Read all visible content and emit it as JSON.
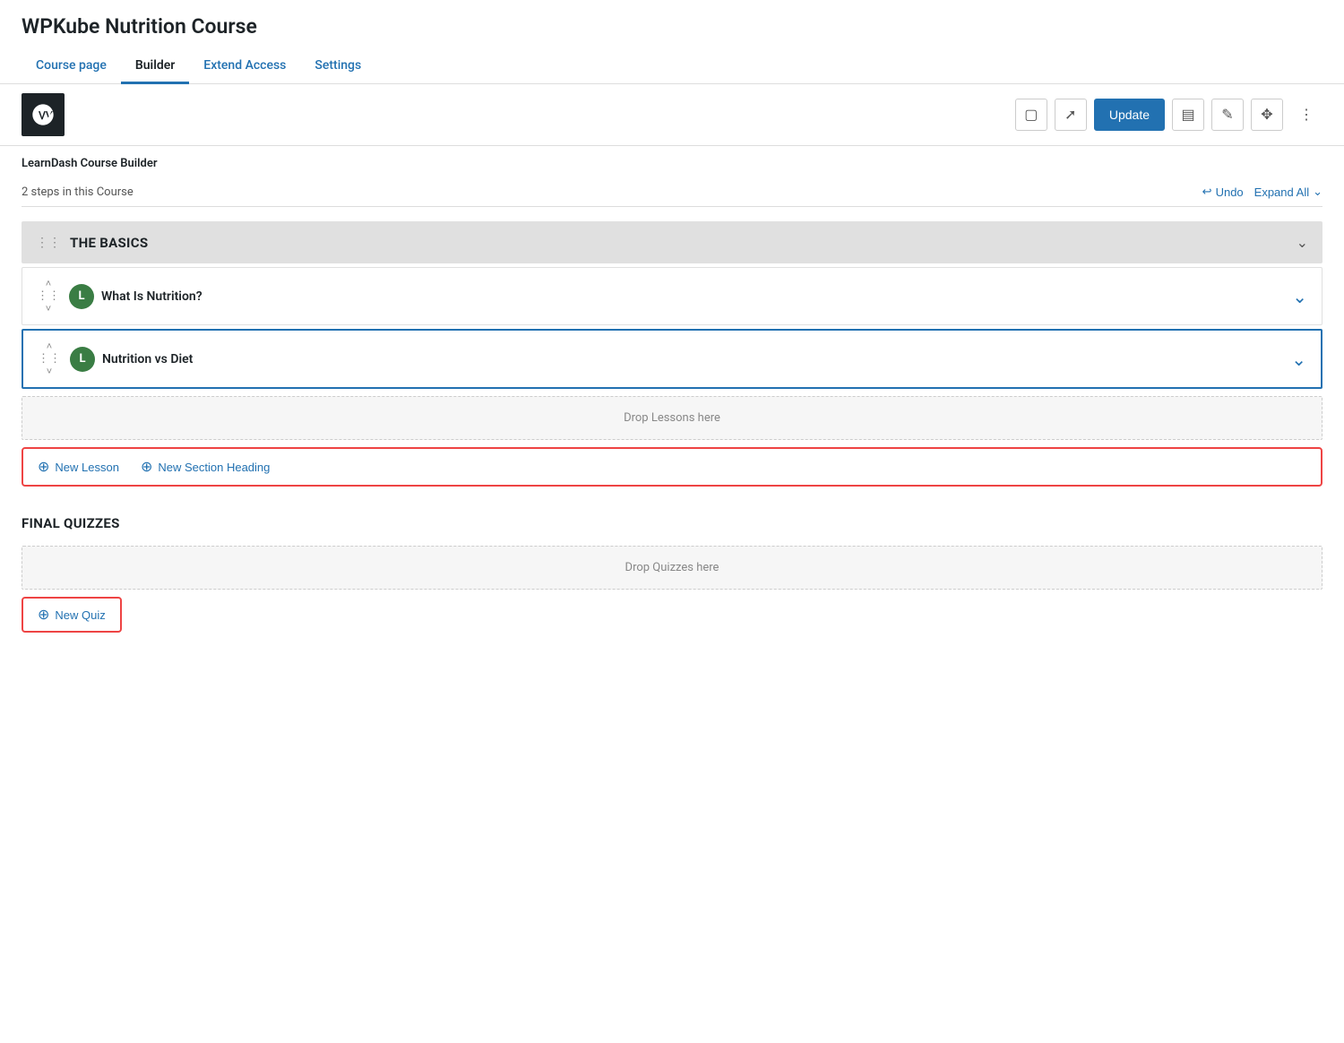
{
  "page": {
    "title": "WPKube Nutrition Course"
  },
  "tabs": [
    {
      "id": "course-page",
      "label": "Course page",
      "active": false
    },
    {
      "id": "builder",
      "label": "Builder",
      "active": true
    },
    {
      "id": "extend-access",
      "label": "Extend Access",
      "active": false
    },
    {
      "id": "settings",
      "label": "Settings",
      "active": false
    }
  ],
  "toolbar": {
    "update_label": "Update",
    "wp_logo": "W"
  },
  "builder": {
    "title": "LearnDash Course Builder",
    "steps_count": "2 steps in this Course",
    "undo_label": "Undo",
    "expand_all_label": "Expand All"
  },
  "sections": [
    {
      "id": "the-basics",
      "title": "THE BASICS",
      "lessons": [
        {
          "id": "what-is-nutrition",
          "title": "What Is Nutrition?",
          "badge": "L",
          "active": false
        },
        {
          "id": "nutrition-vs-diet",
          "title": "Nutrition vs Diet",
          "badge": "L",
          "active": true
        }
      ]
    }
  ],
  "drop_lessons_label": "Drop Lessons here",
  "add_buttons": {
    "new_lesson": "New Lesson",
    "new_section_heading": "New Section Heading"
  },
  "final_quizzes": {
    "title": "FINAL QUIZZES",
    "drop_label": "Drop Quizzes here",
    "new_quiz_label": "New Quiz"
  },
  "icons": {
    "undo": "↩",
    "chevron_down": "∨",
    "chevron_up": "∧",
    "drag": "⠿",
    "expand": "⌄",
    "plus_circle": "⊕",
    "monitor": "□",
    "external": "⬝",
    "columns": "▣",
    "pencil": "✎",
    "lines": "≡",
    "more": "⋮",
    "wp_icon": "Ⓦ"
  }
}
